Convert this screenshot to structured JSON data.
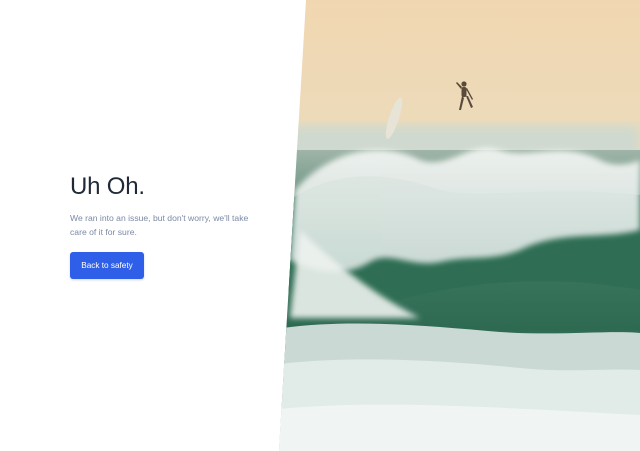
{
  "error": {
    "title": "Uh Oh.",
    "message": "We ran into an issue, but don't worry, we'll take care of it for sure.",
    "back_button_label": "Back to safety"
  },
  "colors": {
    "accent": "#2f5fe8",
    "title": "#1f2937",
    "muted_text": "#7a89a6"
  },
  "image": {
    "subject": "surfer-wipeout-on-breaking-wave"
  }
}
